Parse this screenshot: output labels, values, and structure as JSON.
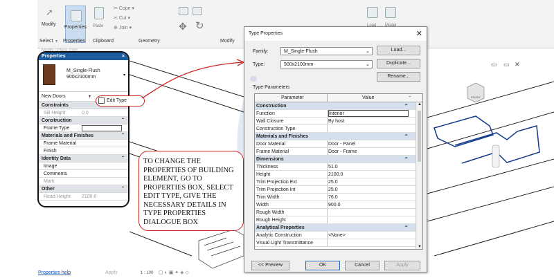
{
  "ribbon": {
    "modify": "Modify",
    "properties": "Properties",
    "paste": "Paste",
    "cope": "Cope",
    "cut": "Cut",
    "join": "Join",
    "load": "Load",
    "model": "Model",
    "select": "Select",
    "clipboard": "Clipboard",
    "geometry": "Geometry",
    "modify_group": "Modify"
  },
  "props_panel": {
    "faded_tab": "Modify | Place Door",
    "title": "Properties",
    "close": "×",
    "family": "M_Single-Flush",
    "type": "900x2100mm",
    "instance": "New Doors",
    "edit_type": "Edit Type",
    "rows": [
      {
        "label": "Constraints",
        "group": true
      },
      {
        "label": "Sill Height",
        "value": "0.0",
        "muted": true
      },
      {
        "label": "Construction",
        "group": true
      },
      {
        "label": "Frame Type",
        "value": ""
      },
      {
        "label": "Materials and Finishes",
        "group": true
      },
      {
        "label": "Frame Material",
        "value": ""
      },
      {
        "label": "Finish",
        "value": ""
      },
      {
        "label": "Identity Data",
        "group": true
      },
      {
        "label": "Image",
        "value": ""
      },
      {
        "label": "Comments",
        "value": ""
      },
      {
        "label": "Mark",
        "value": "",
        "muted": true
      },
      {
        "label": "Other",
        "group": true
      },
      {
        "label": "Head Height",
        "value": "2100.0",
        "muted": true
      }
    ],
    "help": "Properties help",
    "apply": "Apply"
  },
  "canvas": {
    "scale": "1 : 100",
    "view_cube": "FRONT"
  },
  "dialog": {
    "title": "Type Properties",
    "family_label": "Family:",
    "family_value": "M_Single-Flush",
    "type_label": "Type:",
    "type_value": "900x2100mm",
    "load": "Load...",
    "duplicate": "Duplicate...",
    "rename": "Rename...",
    "type_parameters": "Type Parameters",
    "col_parameter": "Parameter",
    "col_value": "Value",
    "rows": [
      {
        "p": "Construction",
        "group": true
      },
      {
        "p": "Function",
        "v": "Interior"
      },
      {
        "p": "Wall Closure",
        "v": "By host"
      },
      {
        "p": "Construction Type",
        "v": ""
      },
      {
        "p": "Materials and Finishes",
        "group": true
      },
      {
        "p": "Door Material",
        "v": "Door - Panel"
      },
      {
        "p": "Frame Material",
        "v": "Door - Frame"
      },
      {
        "p": "Dimensions",
        "group": true
      },
      {
        "p": "Thickness",
        "v": "51.0"
      },
      {
        "p": "Height",
        "v": "2100.0"
      },
      {
        "p": "Trim Projection Ext",
        "v": "25.0"
      },
      {
        "p": "Trim Projection Int",
        "v": "25.0"
      },
      {
        "p": "Trim Width",
        "v": "76.0"
      },
      {
        "p": "Width",
        "v": "900.0"
      },
      {
        "p": "Rough Width",
        "v": ""
      },
      {
        "p": "Rough Height",
        "v": ""
      },
      {
        "p": "Analytical Properties",
        "group": true
      },
      {
        "p": "Analytic Construction",
        "v": "<None>"
      },
      {
        "p": "Visual Light Transmittance",
        "v": ""
      }
    ],
    "preview": "<< Preview",
    "ok": "OK",
    "cancel": "Cancel",
    "apply": "Apply"
  },
  "annotation": "TO CHANGE THE PROPERTIES OF BUILDING ELEMENT, GO TO PROPERTIES BOX, SELECT EDIT TYPE, GIVE THE NECESSARY DETAILS IN TYPE PROPERTIES DIALOGUE BOX",
  "colors": {
    "accent": "#1c5b9c",
    "annotation": "#cc2222",
    "watermark": "#2f6fb5"
  }
}
